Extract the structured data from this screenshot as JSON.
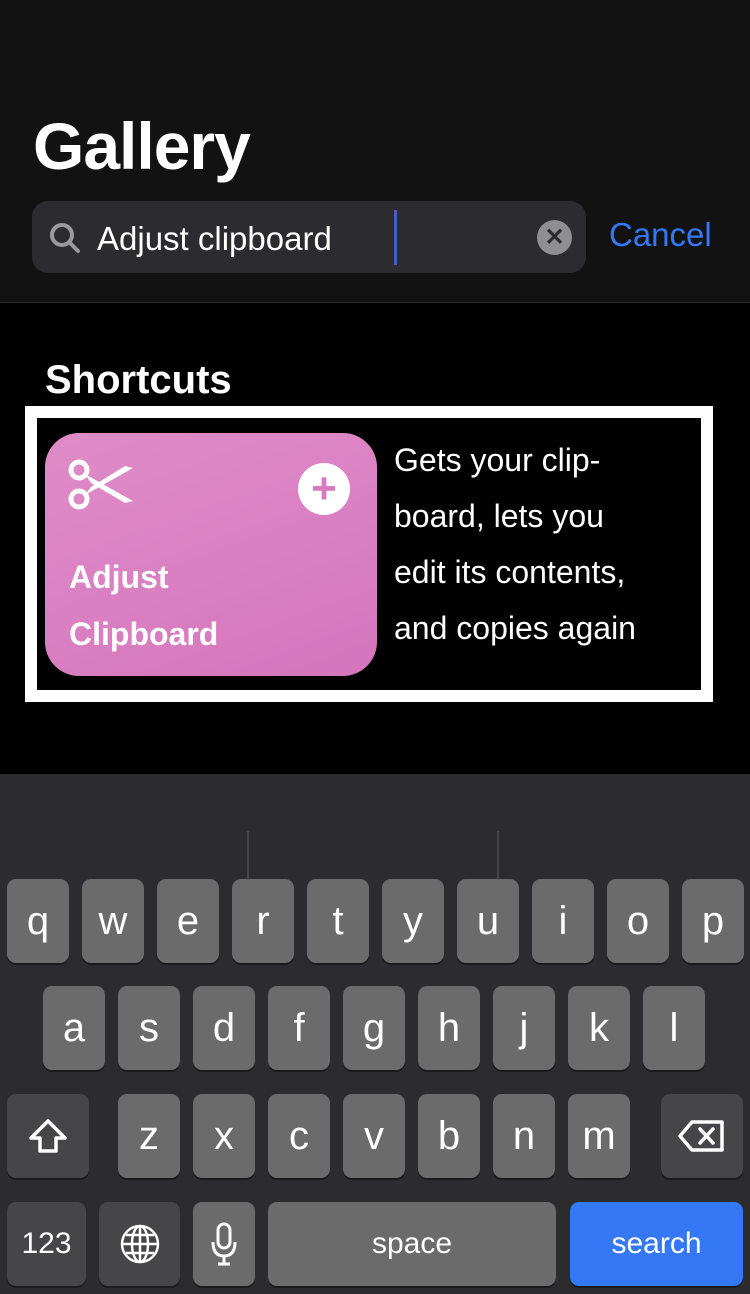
{
  "header": {
    "title": "Gallery",
    "search": {
      "value": "Adjust clipboard",
      "clear_icon": "clear-icon",
      "search_icon": "search-icon"
    },
    "cancel_label": "Cancel"
  },
  "results": {
    "section_title": "Shortcuts",
    "shortcut": {
      "title_line1": "Adjust",
      "title_line2": "Clipboard",
      "icon": "scissors-icon",
      "add_icon": "plus-icon",
      "color": "#d67bbf",
      "description_lines": [
        "Gets your clip-",
        "board, lets you",
        "edit its contents,",
        "and copies again"
      ]
    }
  },
  "keyboard": {
    "row1": [
      "q",
      "w",
      "e",
      "r",
      "t",
      "y",
      "u",
      "i",
      "o",
      "p"
    ],
    "row2": [
      "a",
      "s",
      "d",
      "f",
      "g",
      "h",
      "j",
      "k",
      "l"
    ],
    "row3": [
      "z",
      "x",
      "c",
      "v",
      "b",
      "n",
      "m"
    ],
    "numbers_label": "123",
    "space_label": "space",
    "search_label": "search",
    "accent_color": "#3478f6"
  }
}
